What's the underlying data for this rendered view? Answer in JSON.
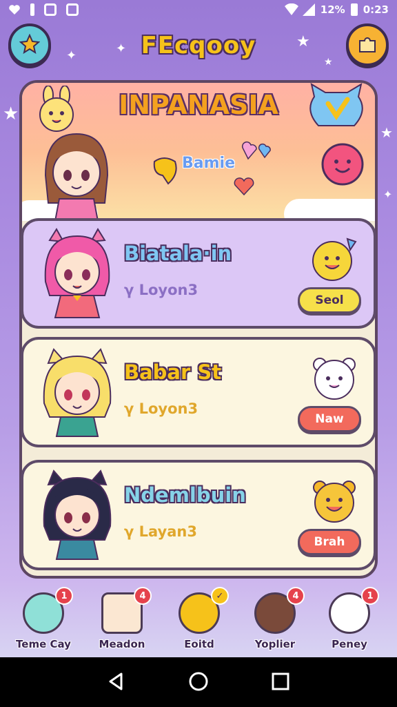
{
  "status_bar": {
    "battery_text": "12%",
    "time": "0:23"
  },
  "header": {
    "title": "FEcqooy",
    "left_button_icon": "star-icon",
    "right_button_icon": "puzzle-icon"
  },
  "banner": {
    "title": "INPANASIA",
    "label": "Bamie",
    "mascot_icon": "blue-cat-heart-icon",
    "smile_icon": "pink-smiley-icon"
  },
  "cards": [
    {
      "name": "Biatala·in",
      "subtitle": "γ Loyon3",
      "button": "Seol",
      "name_color": "#7fc6f2",
      "button_color": "#f6e04a"
    },
    {
      "name": "Babar St",
      "subtitle": "γ Loyon3",
      "button": "Naw",
      "name_color": "#f6c21a",
      "button_color": "#f26a5c"
    },
    {
      "name": "Ndemlbuin",
      "subtitle": "γ Layan3",
      "button": "Brah",
      "name_color": "#86d3e8",
      "button_color": "#f26a5c"
    }
  ],
  "bottom_nav": [
    {
      "label": "Teme Cay",
      "badge": "1",
      "color": "#8fe0d7",
      "icon": "slime-icon"
    },
    {
      "label": "Meadon",
      "badge": "4",
      "color": "#fbe7d2",
      "icon": "box-icon"
    },
    {
      "label": "Eoitd",
      "badge": "✓",
      "color": "#f6c21a",
      "icon": "gold-coin-icon"
    },
    {
      "label": "Yoplier",
      "badge": "4",
      "color": "#7a4a3a",
      "icon": "chocolate-icon"
    },
    {
      "label": "Peney",
      "badge": "1",
      "color": "#ffffff",
      "icon": "cloud-icon"
    }
  ],
  "colors": {
    "background": "#a98ae0",
    "panel": "#f4ecd8",
    "outline": "#5e4b69"
  }
}
